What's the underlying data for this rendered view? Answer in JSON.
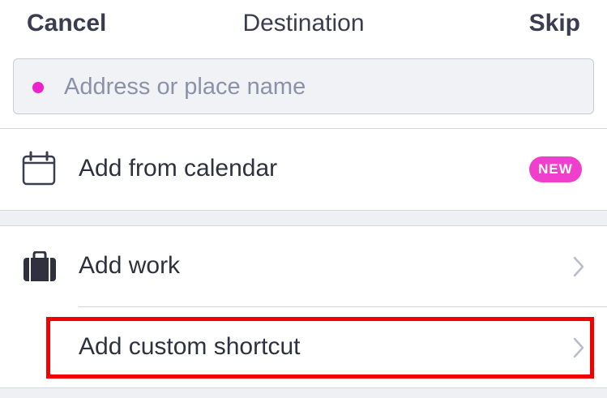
{
  "header": {
    "cancel_label": "Cancel",
    "title": "Destination",
    "skip_label": "Skip"
  },
  "search": {
    "placeholder": "Address or place name",
    "value": "",
    "dot_color": "#ee22cc"
  },
  "rows": [
    {
      "label": "Add from calendar",
      "icon": "calendar-icon",
      "badge": "NEW",
      "badge_color": "#f03ecd"
    },
    {
      "label": "Add work",
      "icon": "briefcase-icon",
      "chevron": "chevron-right-icon"
    },
    {
      "label": "Add custom shortcut",
      "chevron": "chevron-right-icon",
      "highlighted": true,
      "highlight_color": "#f20000"
    }
  ]
}
